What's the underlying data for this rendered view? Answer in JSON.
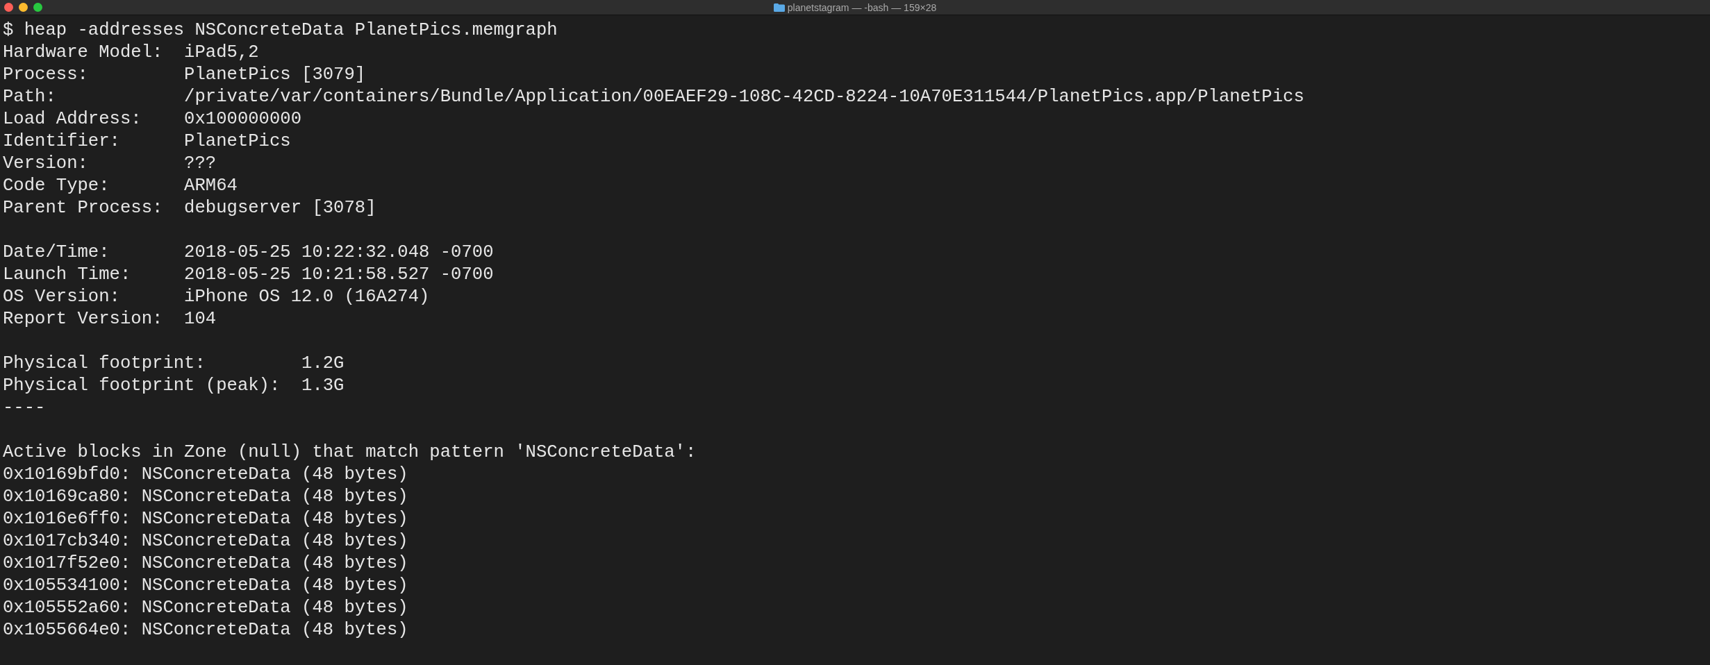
{
  "window": {
    "title": "planetstagram — -bash — 159×28"
  },
  "terminal": {
    "blocks": [
      [
        "$ heap -addresses NSConcreteData PlanetPics.memgraph",
        "Hardware Model:  iPad5,2",
        "Process:         PlanetPics [3079]",
        "Path:            /private/var/containers/Bundle/Application/00EAEF29-108C-42CD-8224-10A70E311544/PlanetPics.app/PlanetPics",
        "Load Address:    0x100000000",
        "Identifier:      PlanetPics",
        "Version:         ???",
        "Code Type:       ARM64",
        "Parent Process:  debugserver [3078]"
      ],
      [
        "Date/Time:       2018-05-25 10:22:32.048 -0700",
        "Launch Time:     2018-05-25 10:21:58.527 -0700",
        "OS Version:      iPhone OS 12.0 (16A274)",
        "Report Version:  104"
      ],
      [
        "Physical footprint:         1.2G",
        "Physical footprint (peak):  1.3G",
        "----"
      ],
      [
        "Active blocks in Zone (null) that match pattern 'NSConcreteData':",
        "0x10169bfd0: NSConcreteData (48 bytes)",
        "0x10169ca80: NSConcreteData (48 bytes)",
        "0x1016e6ff0: NSConcreteData (48 bytes)",
        "0x1017cb340: NSConcreteData (48 bytes)",
        "0x1017f52e0: NSConcreteData (48 bytes)",
        "0x105534100: NSConcreteData (48 bytes)",
        "0x105552a60: NSConcreteData (48 bytes)",
        "0x1055664e0: NSConcreteData (48 bytes)"
      ]
    ]
  }
}
